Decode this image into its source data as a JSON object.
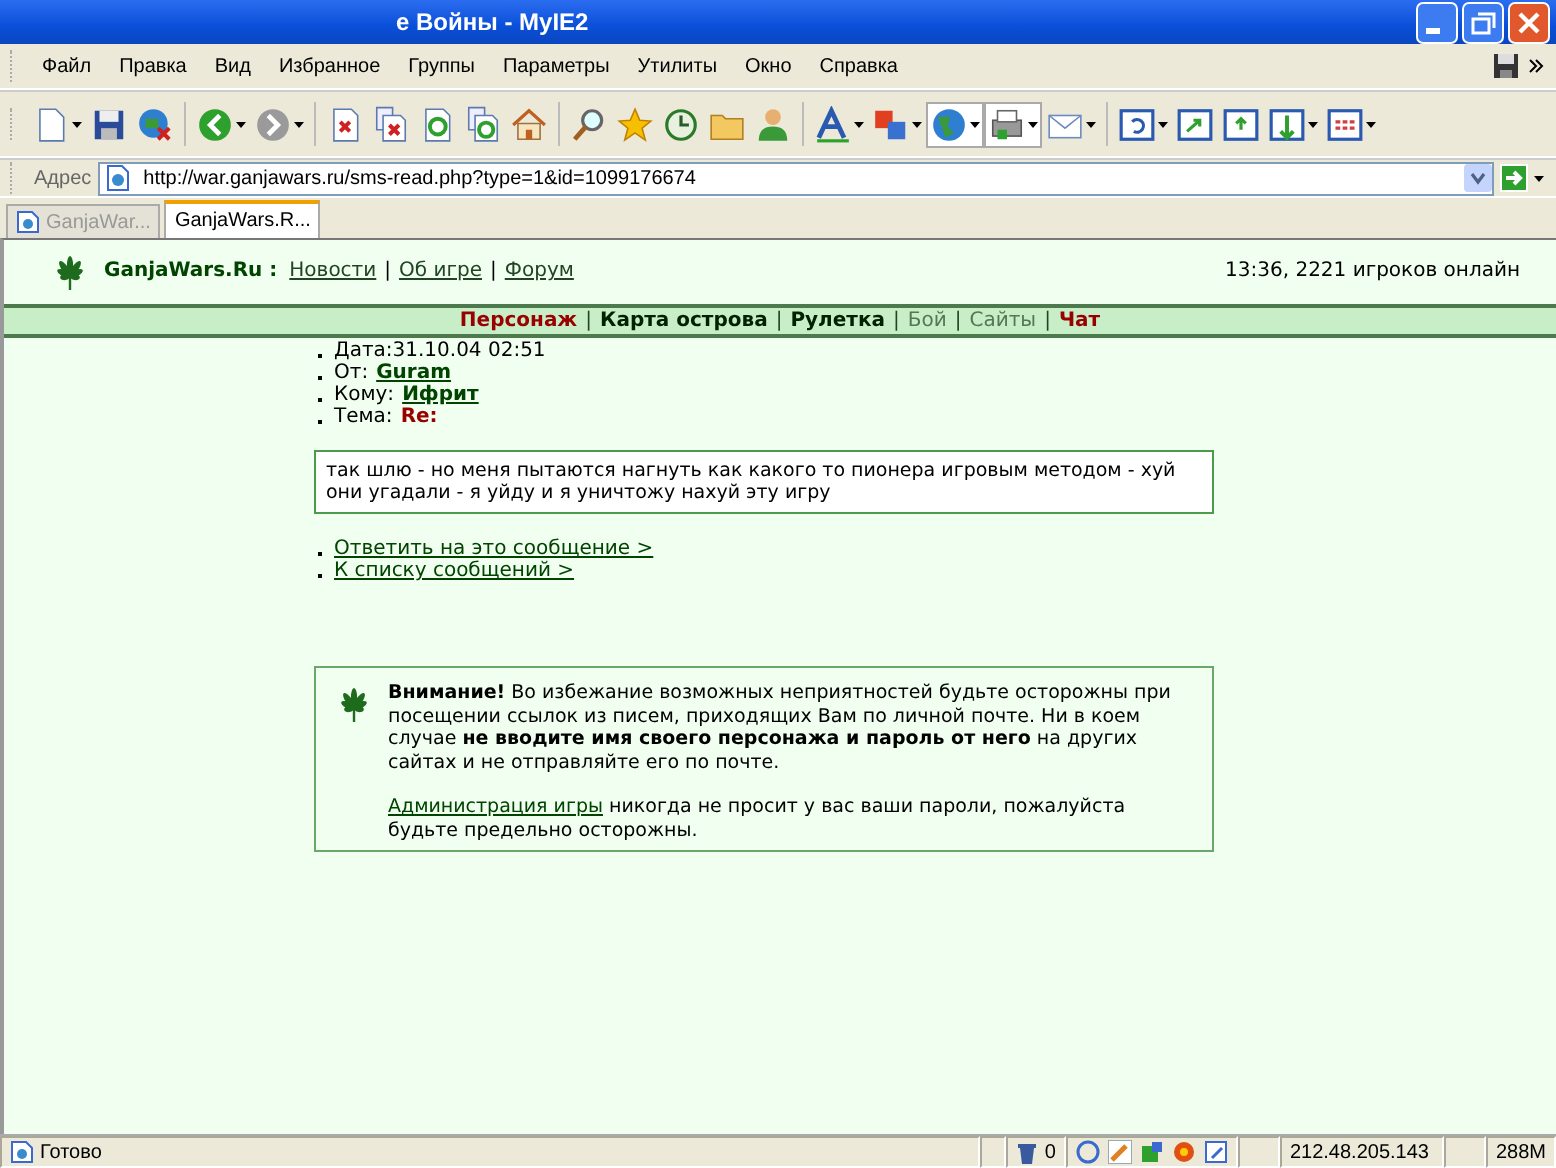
{
  "window": {
    "title": "е Войны - MyIE2"
  },
  "menu": [
    "Файл",
    "Правка",
    "Вид",
    "Избранное",
    "Группы",
    "Параметры",
    "Утилиты",
    "Окно",
    "Справка"
  ],
  "address": {
    "label": "Адрес",
    "value": "http://war.ganjawars.ru/sms-read.php?type=1&id=1099176674"
  },
  "tabs": [
    {
      "label": "GanjaWar...",
      "selected": false
    },
    {
      "label": "GanjaWars.R...",
      "selected": true
    }
  ],
  "header": {
    "site": "GanjaWars.Ru :",
    "links": [
      "Новости",
      "Об игре",
      "Форум"
    ],
    "separators": [
      "|",
      "|"
    ],
    "online": "13:36, 2221 игроков онлайн"
  },
  "nav": [
    {
      "label": "Персонаж",
      "kind": "accent"
    },
    {
      "label": "Карта острова",
      "kind": "bold"
    },
    {
      "label": "Рулетка",
      "kind": "bold"
    },
    {
      "label": "Бой",
      "kind": "plain"
    },
    {
      "label": "Сайты",
      "kind": "plain"
    },
    {
      "label": "Чат",
      "kind": "accent"
    }
  ],
  "nav_separators": [
    "|",
    "|",
    "|",
    "|",
    "|"
  ],
  "message": {
    "fields": [
      {
        "label": "Дата:31.10.04 02:51"
      },
      {
        "label": "От:",
        "value": "Guram",
        "kind": "link"
      },
      {
        "label": "Кому:",
        "value": "Ифрит",
        "kind": "link"
      },
      {
        "label": "Тема:",
        "value": "Re:",
        "kind": "accent"
      }
    ],
    "body": "так шлю - но меня пытаются нагнуть как какого то пионера игровым методом - хуй они угадали - я уйду и я уничтожу нахуй эту игру",
    "actions": [
      "Ответить на это сообщение >",
      "К списку сообщений >"
    ]
  },
  "warning": {
    "text": "**Внимание!** Во избежание возможных неприятностей будьте осторожны при посещении ссылок из писем, приходящих Вам по личной почте. Ни в коем случае **не вводите имя своего персонажа и пароль от него** на других сайтах и не отправляйте его по почте.",
    "link": "Администрация игры",
    "after": " никогда не просит у вас ваши пароли, пожалуйста будьте предельно осторожны."
  },
  "status_bar": {
    "text": "Готово",
    "trash_count": "0",
    "ip": "212.48.205.143",
    "memory": "288M"
  }
}
